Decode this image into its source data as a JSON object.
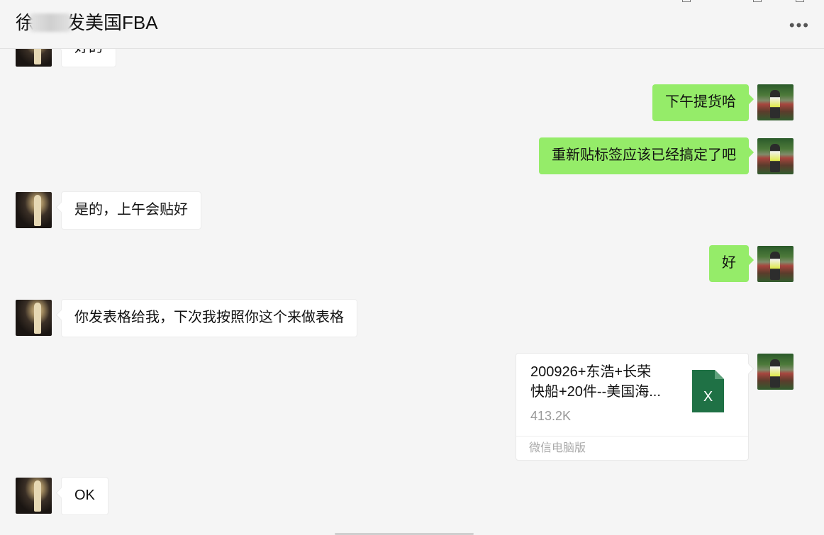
{
  "header": {
    "title_prefix": "徐",
    "title_suffix": "发美国FBA",
    "more_label": "•••"
  },
  "messages": [
    {
      "side": "left",
      "text": "好的"
    },
    {
      "side": "right",
      "text": "下午提货哈"
    },
    {
      "side": "right",
      "text": "重新贴标签应该已经搞定了吧"
    },
    {
      "side": "left",
      "text": "是的，上午会贴好"
    },
    {
      "side": "right",
      "text": "好"
    },
    {
      "side": "left",
      "text": "你发表格给我，下次我按照你这个来做表格"
    },
    {
      "side": "left",
      "text": "OK"
    }
  ],
  "file": {
    "name_line1": "200926+东浩+长荣",
    "name_line2": "快船+20件--美国海...",
    "size": "413.2K",
    "source": "微信电脑版",
    "icon_letter": "X",
    "icon_color": "#1f7145"
  },
  "colors": {
    "background": "#f5f5f5",
    "self_bubble": "#95ec69",
    "other_bubble": "#ffffff"
  }
}
